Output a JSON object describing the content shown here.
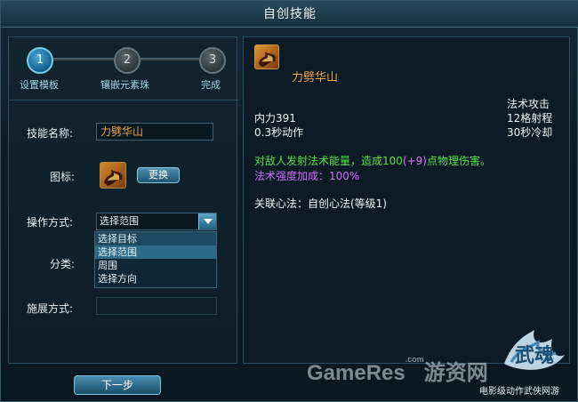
{
  "window": {
    "title": "自创技能"
  },
  "steps": [
    {
      "number": "1",
      "label": "设置模板"
    },
    {
      "number": "2",
      "label": "镶嵌元素珠"
    },
    {
      "number": "3",
      "label": "完成"
    }
  ],
  "form": {
    "name_label": "技能名称:",
    "name_value": "力劈华山",
    "icon_label": "图标:",
    "change_button": "更换",
    "operation_label": "操作方式:",
    "operation_value": "选择范围",
    "operation_options": [
      "选择目标",
      "选择范围",
      "周围",
      "选择方向"
    ],
    "category_label": "分类:",
    "cast_label": "施展方式:",
    "next_button": "下一步"
  },
  "skill": {
    "name": "力劈华山",
    "type": "法术攻击",
    "cost": "内力391",
    "range": "12格射程",
    "cast_time": "0.3秒动作",
    "cooldown": "30秒冷却",
    "desc_prefix": "对敌人发射法术能量，造成100",
    "desc_plus": "(+9)",
    "desc_suffix": "点物理伤害。",
    "strength_bonus": "法术强度加成：100%",
    "linked_method": "关联心法：自创心法(等级1)"
  },
  "branding": {
    "watermark": "GameRes",
    "watermark_small": ".com",
    "watermark_cn": "游资网",
    "logo_text": "武魂",
    "tagline": "电影级动作武侠网游"
  },
  "colors": {
    "skill_name": "#f0a24b",
    "description": "#58e34a",
    "bonus": "#d36cff"
  }
}
